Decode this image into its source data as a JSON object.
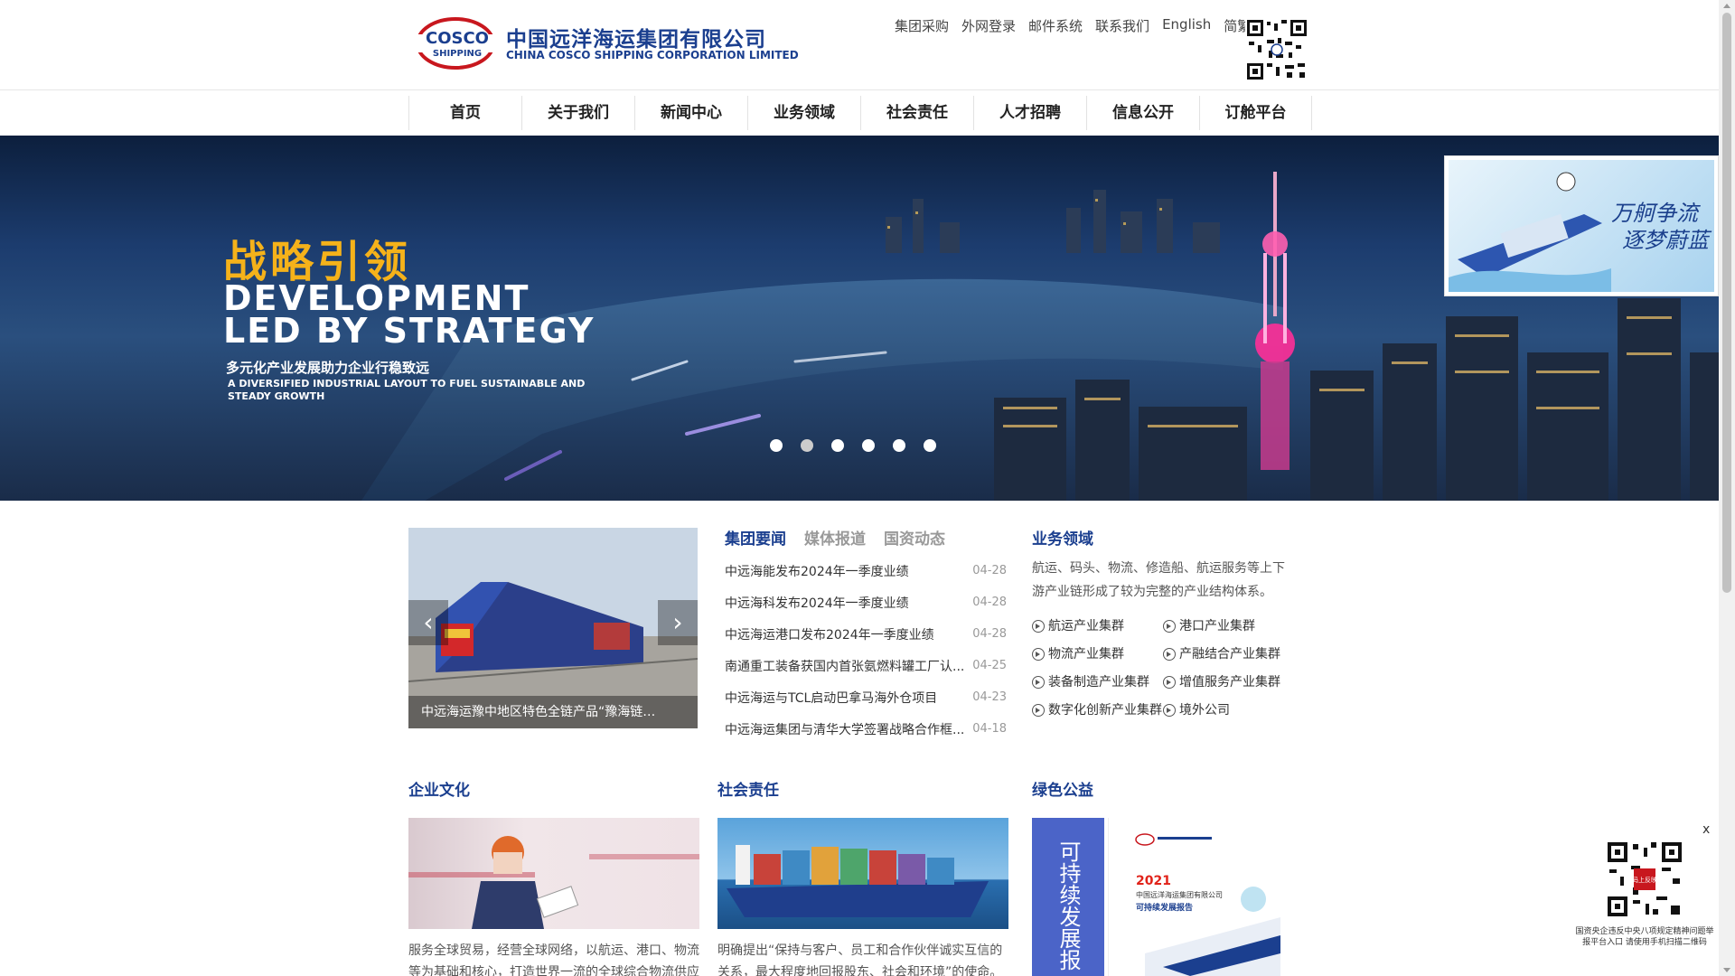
{
  "brand": {
    "logo_mark": "COSCO SHIPPING",
    "name_cn": "中国远洋海运集团有限公司",
    "name_en": "CHINA COSCO SHIPPING CORPORATION LIMITED",
    "primary_color": "#1b3f8f",
    "accent_color": "#f5b21a"
  },
  "top_links": [
    "集团采购",
    "外网登录",
    "邮件系统",
    "联系我们",
    "English",
    "简繁"
  ],
  "nav": [
    "首页",
    "关于我们",
    "新闻中心",
    "业务领域",
    "社会责任",
    "人才招聘",
    "信息公开",
    "订舱平台"
  ],
  "banner": {
    "title_cn": "战略引领",
    "title_en_1": "DEVELOPMENT",
    "title_en_2": "LED BY STRATEGY",
    "subtitle_cn": "多元化产业发展助力企业行稳致远",
    "subtitle_en": "A DIVERSIFIED INDUSTRIAL LAYOUT TO FUEL SUSTAINABLE AND STEADY GROWTH",
    "slide_count": 6,
    "active_slide": 2
  },
  "ad": {
    "text_1": "万舸争流",
    "text_2": "逐梦蔚蓝"
  },
  "photo_news": {
    "caption": "中远海运豫中地区特色全链产品“豫海链…"
  },
  "news": {
    "tabs": [
      "集团要闻",
      "媒体报道",
      "国资动态"
    ],
    "active_tab": 0,
    "items": [
      {
        "title": "中远海能发布2024年一季度业绩",
        "date": "04-28"
      },
      {
        "title": "中远海科发布2024年一季度业绩",
        "date": "04-28"
      },
      {
        "title": "中远海运港口发布2024年一季度业绩",
        "date": "04-28"
      },
      {
        "title": "南通重工装备获国内首张氨燃料罐工厂认...",
        "date": "04-25"
      },
      {
        "title": "中远海运与TCL启动巴拿马海外仓项目",
        "date": "04-23"
      },
      {
        "title": "中远海运集团与清华大学签署战略合作框...",
        "date": "04-18"
      }
    ]
  },
  "business": {
    "title": "业务领域",
    "desc": "航运、码头、物流、修造船、航运服务等上下游产业链形成了较为完整的产业结构体系。",
    "items": [
      "航运产业集群",
      "港口产业集群",
      "物流产业集群",
      "产融结合产业集群",
      "装备制造产业集群",
      "增值服务产业集群",
      "数字化创新产业集群",
      "境外公司"
    ]
  },
  "culture": {
    "title": "企业文化",
    "text": "服务全球贸易，经营全球网络，以航运、港口、物流等为基础和核心，打造世界一流的全球综合物流供应"
  },
  "csr": {
    "title": "社会责任",
    "text": "明确提出“保持与客户、员工和合作伙伴诚实互信的关系，最大程度地回报股东、社会和环境”的使命。"
  },
  "green": {
    "title": "绿色公益",
    "box_text": "可持续发展报",
    "report_year": "2021",
    "report_line_1": "中国远洋海运集团有限公司",
    "report_line_2": "可持续发展报告"
  },
  "float_qr": {
    "close": "x",
    "stamp": "码上反映",
    "caption": "国资央企违反中央八项规定精神问题举报平台入口 请使用手机扫描二维码"
  }
}
